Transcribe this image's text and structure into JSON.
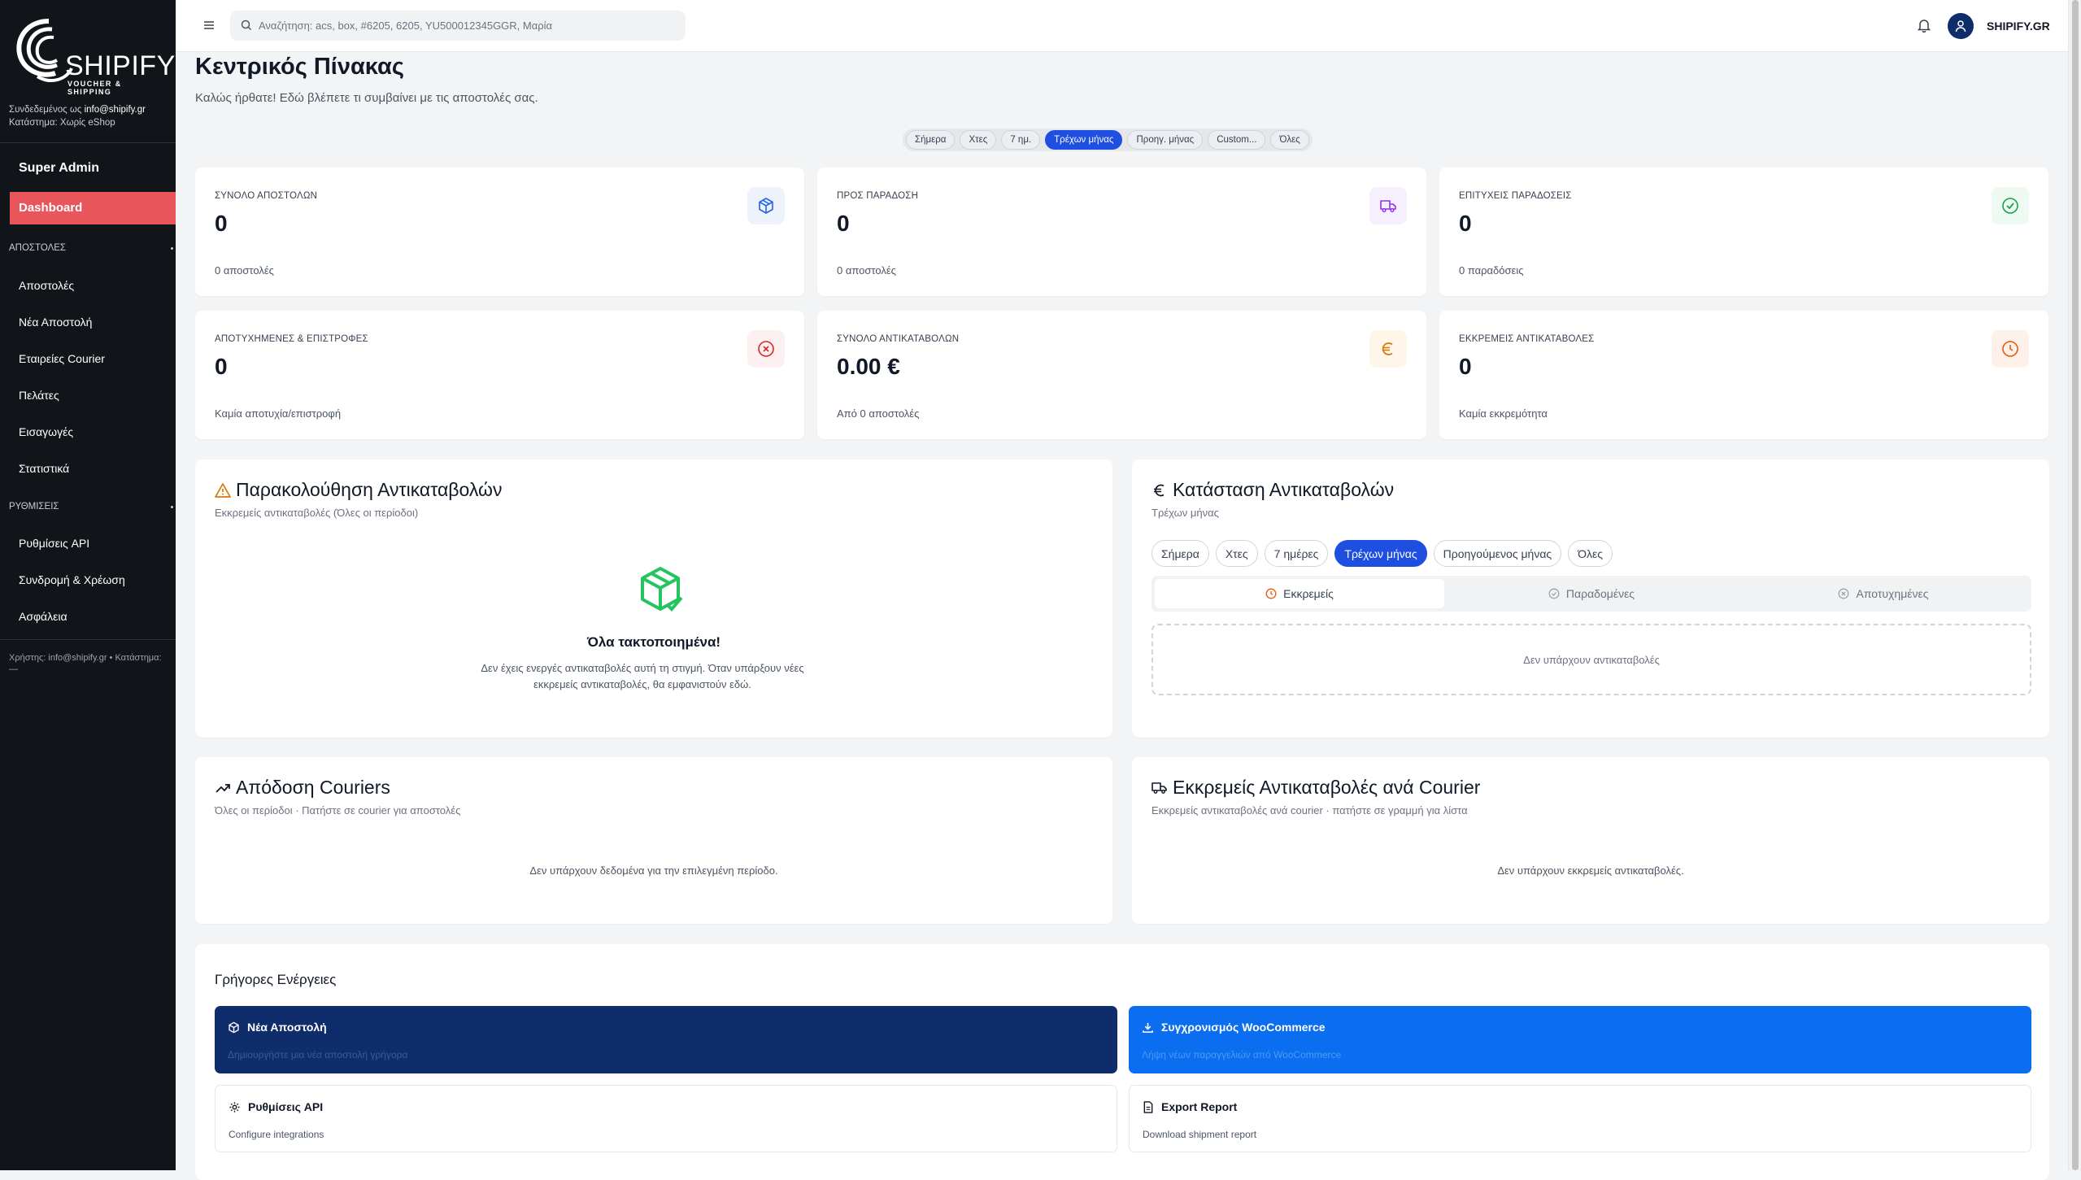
{
  "sidebar": {
    "logo": {
      "name": "SHIPIFY",
      "tagline": "VOUCHER & SHIPPING"
    },
    "meta_login_prefix": "Συνδεδεμένος ως",
    "meta_login_email": "info@shipify.gr",
    "meta_store_prefix": "Κατάστημα:",
    "meta_store_value": "Χωρίς eShop",
    "role_title": "Super Admin",
    "active_item": "Dashboard",
    "section_shipments": "ΑΠΟΣΤΟΛΕΣ",
    "items_shipments": [
      "Αποστολές",
      "Νέα Αποστολή",
      "Εταιρείες Courier",
      "Πελάτες",
      "Εισαγωγές",
      "Στατιστικά"
    ],
    "section_settings": "ΡΥΘΜΙΣΕΙΣ",
    "items_settings": [
      "Ρυθμίσεις API",
      "Συνδρομή & Χρέωση",
      "Ασφάλεια"
    ],
    "footer": "Χρήστης: info@shipify.gr • Κατάστημα: —"
  },
  "topbar": {
    "search_placeholder": "Αναζήτηση: acs, box, #6205, 6205, YU500012345GGR, Μαρία",
    "user_label": "SHIPIFY.GR"
  },
  "page": {
    "title": "Κεντρικός Πίνακας",
    "subtitle": "Καλώς ήρθατε! Εδώ βλέπετε τι συμβαίνει με τις αποστολές σας."
  },
  "period_filter": {
    "options": [
      "Σήμερα",
      "Χτες",
      "7 ημ.",
      "Τρέχων μήνας",
      "Προηγ. μήνας",
      "Custom...",
      "Όλες"
    ],
    "selected": "Τρέχων μήνας"
  },
  "kpis": [
    {
      "label": "ΣΥΝΟΛΟ ΑΠΟΣΤΟΛΩΝ",
      "value": "0",
      "sub": "0 αποστολές",
      "icon": "package-icon",
      "color": "#2563eb",
      "bg": "#eef2fb"
    },
    {
      "label": "ΠΡΟΣ ΠΑΡΑΔΟΣΗ",
      "value": "0",
      "sub": "0 αποστολές",
      "icon": "truck-icon",
      "color": "#9333ea",
      "bg": "#f6effd"
    },
    {
      "label": "ΕΠΙΤΥΧΕΙΣ ΠΑΡΑΔΟΣΕΙΣ",
      "value": "0",
      "sub": "0 παραδόσεις",
      "icon": "check-circle-icon",
      "color": "#16a34a",
      "bg": "#edf9f1"
    },
    {
      "label": "ΑΠΟΤΥΧΗΜΕΝΕΣ & ΕΠΙΣΤΡΟΦΕΣ",
      "value": "0",
      "sub": "Καμία αποτυχία/επιστροφή",
      "icon": "x-circle-icon",
      "color": "#dc2626",
      "bg": "#fdf0f0"
    },
    {
      "label": "ΣΥΝΟΛΟ ΑΝΤΙΚΑΤΑΒΟΛΩΝ",
      "value": "0.00 €",
      "sub": "Από 0 αποστολές",
      "icon": "euro-icon",
      "color": "#d97706",
      "bg": "#fdf6e9"
    },
    {
      "label": "ΕΚΚΡΕΜΕΙΣ ΑΝΤΙΚΑΤΑΒΟΛΕΣ",
      "value": "0",
      "sub": "Καμία εκκρεμότητα",
      "icon": "clock-icon",
      "color": "#ea580c",
      "bg": "#fdf1ea"
    }
  ],
  "cod_tracking": {
    "title": "Παρακολούθηση Αντικαταβολών",
    "subtitle": "Εκκρεμείς αντικαταβολές (Όλες οι περίοδοι)",
    "empty_title": "Όλα τακτοποιημένα!",
    "empty_text": "Δεν έχεις ενεργές αντικαταβολές αυτή τη στιγμή. Όταν υπάρξουν νέες εκκρεμείς αντικαταβολές, θα εμφανιστούν εδώ."
  },
  "cod_status": {
    "title": "Κατάσταση Αντικαταβολών",
    "subtitle": "Τρέχων μήνας",
    "filters": [
      "Σήμερα",
      "Χτες",
      "7 ημέρες",
      "Τρέχων μήνας",
      "Προηγούμενος μήνας",
      "Όλες"
    ],
    "selected": "Τρέχων μήνας",
    "tabs": [
      "Εκκρεμείς",
      "Παραδομένες",
      "Αποτυχημένες"
    ],
    "active_tab": "Εκκρεμείς",
    "empty": "Δεν υπάρχουν αντικαταβολές"
  },
  "couriers_perf": {
    "title": "Απόδοση Couriers",
    "subtitle": "Όλες οι περίοδοι · Πατήστε σε courier για αποστολές",
    "empty": "Δεν υπάρχουν δεδομένα για την επιλεγμένη περίοδο."
  },
  "pending_by_courier": {
    "title": "Εκκρεμείς Αντικαταβολές ανά Courier",
    "subtitle": "Εκκρεμείς αντικαταβολές ανά courier · πατήστε σε γραμμή για λίστα",
    "empty": "Δεν υπάρχουν εκκρεμείς αντικαταβολές."
  },
  "quick_actions": {
    "title": "Γρήγορες Ενέργειες",
    "items": [
      {
        "title": "Νέα Αποστολή",
        "desc": "Δημιουργήστε μια νέα αποστολή γρήγορα"
      },
      {
        "title": "Συγχρονισμός WooCommerce",
        "desc": "Λήψη νέων παραγγελιών από WooCommerce"
      },
      {
        "title": "Ρυθμίσεις API",
        "desc": "Configure integrations"
      },
      {
        "title": "Export Report",
        "desc": "Download shipment report"
      }
    ]
  },
  "colors": {
    "primary": "#1e4fe0",
    "sidebar_bg": "#111419",
    "active_red": "#e8555a",
    "navy": "#0f2d6b",
    "blue": "#0b6ef0"
  }
}
